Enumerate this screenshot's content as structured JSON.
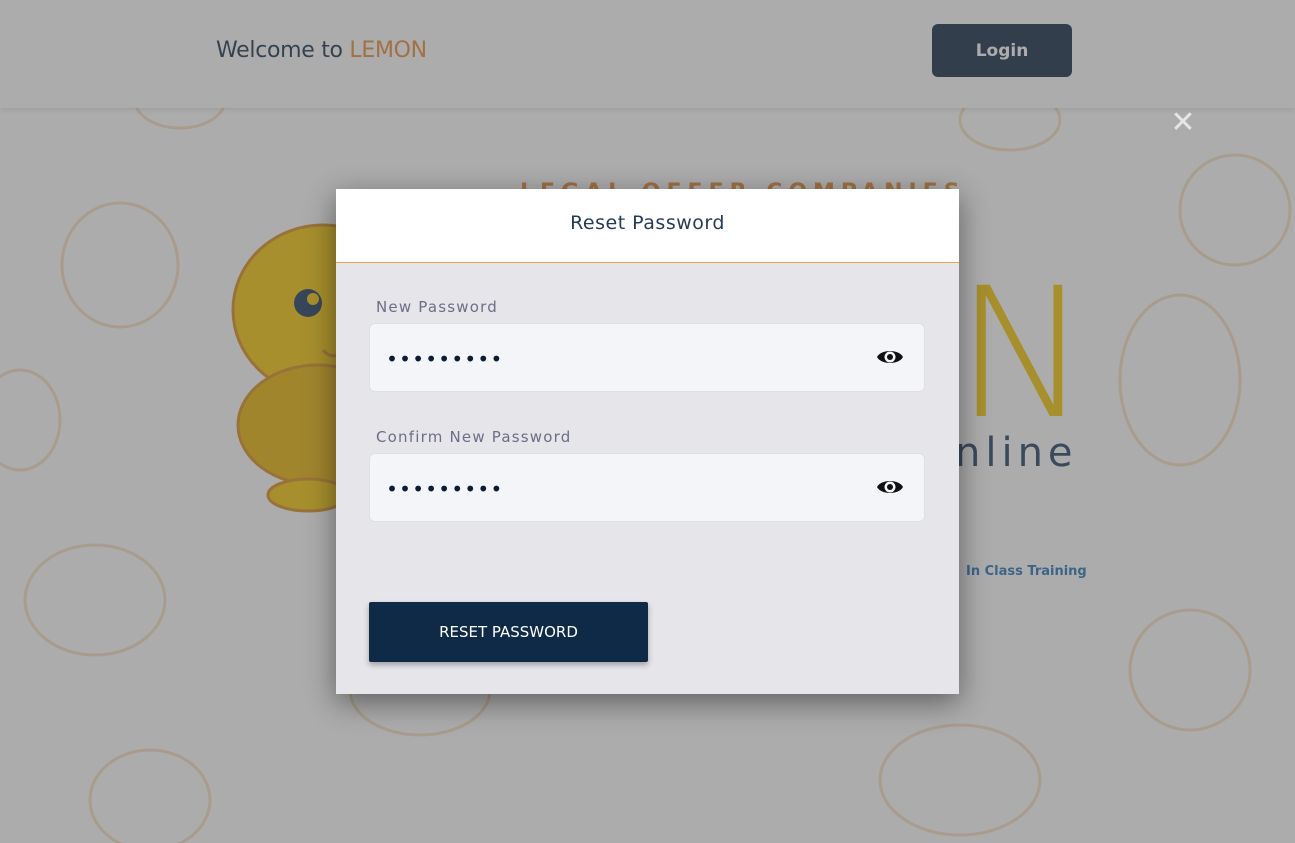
{
  "header": {
    "welcome_prefix": "Welcome to ",
    "brand_name": "LEMON",
    "login_label": "Login"
  },
  "background": {
    "tagline": "LEGAL OFFER COMPANIES",
    "logo_letter": "N",
    "logo_word": "nline",
    "training_link": "In Class Training",
    "close_symbol": "✕"
  },
  "modal": {
    "title": "Reset Password",
    "new_password": {
      "label": "New Password",
      "value": "•••••••••",
      "toggle_icon": "eye-icon"
    },
    "confirm_password": {
      "label": "Confirm New Password",
      "value": "•••••••••",
      "toggle_icon": "eye-icon"
    },
    "submit_label": "RESET PASSWORD"
  },
  "colors": {
    "brand_navy": "#0e2a47",
    "brand_orange": "#e8872c",
    "lemon_yellow": "#f5c400"
  }
}
